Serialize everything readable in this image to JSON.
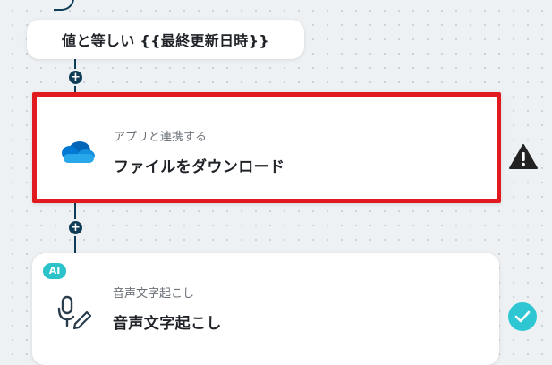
{
  "condition_node": {
    "label": "値と等しい {{最終更新日時}}"
  },
  "download_node": {
    "category": "アプリと連携する",
    "title": "ファイルをダウンロード",
    "icon": "onedrive-icon",
    "status": "warning"
  },
  "voice_node": {
    "badge": "AI",
    "category": "音声文字起こし",
    "title": "音声文字起こし",
    "icon": "microphone-pen-icon",
    "status": "complete"
  },
  "add_buttons": {
    "symbol": "+"
  },
  "colors": {
    "connector": "#0f3d57",
    "highlight_border": "#e01a1f",
    "ai_badge": "#2bc2c9",
    "check": "#2fc6d3"
  }
}
